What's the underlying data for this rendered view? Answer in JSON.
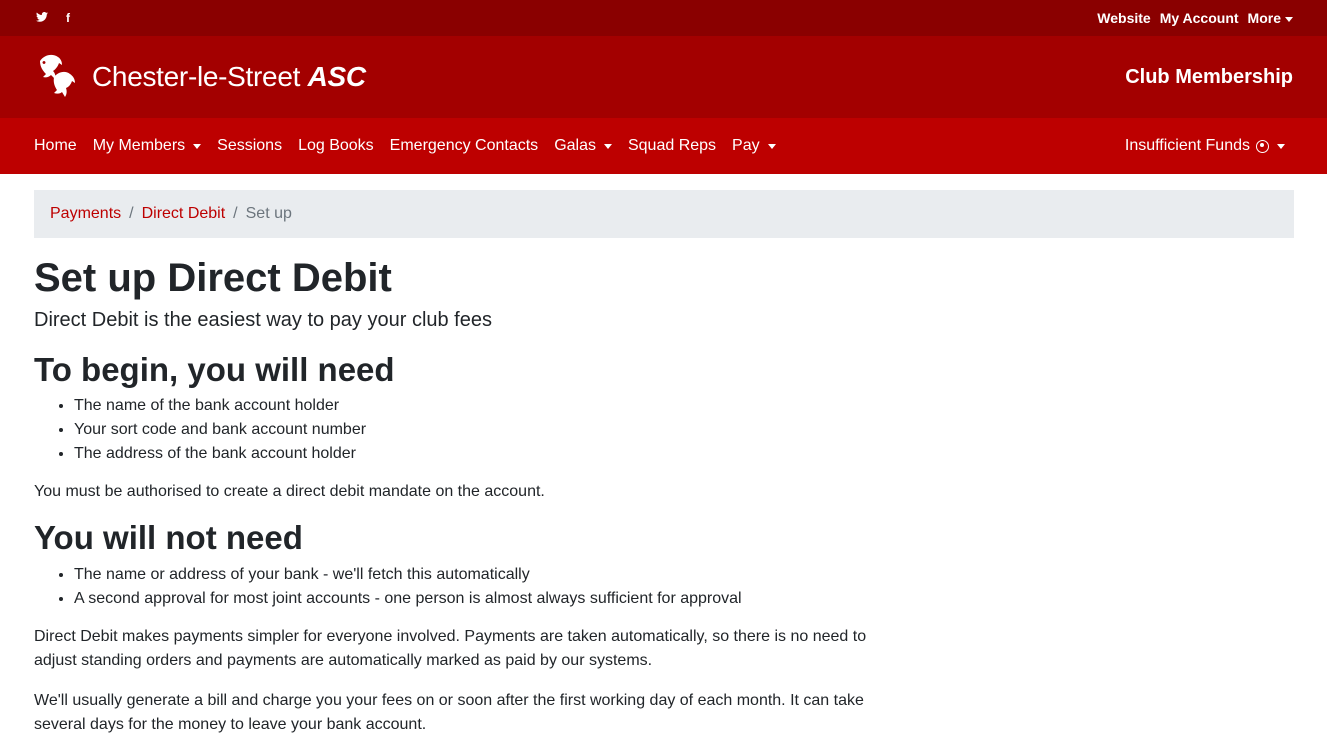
{
  "topbar": {
    "social": [
      "twitter-icon",
      "facebook-icon"
    ],
    "social_glyphs": {
      "twitter": "🐦",
      "facebook": "f"
    },
    "links": [
      "Website",
      "My Account",
      "More"
    ]
  },
  "brand": {
    "name_main": "Chester-le-Street ",
    "name_abbr": "ASC",
    "right_title": "Club Membership"
  },
  "nav": {
    "items": [
      {
        "label": "Home",
        "dropdown": false
      },
      {
        "label": "My Members",
        "dropdown": true
      },
      {
        "label": "Sessions",
        "dropdown": false
      },
      {
        "label": "Log Books",
        "dropdown": false
      },
      {
        "label": "Emergency Contacts",
        "dropdown": false
      },
      {
        "label": "Galas",
        "dropdown": true
      },
      {
        "label": "Squad Reps",
        "dropdown": false
      },
      {
        "label": "Pay",
        "dropdown": true
      }
    ],
    "user": "Insufficient Funds"
  },
  "breadcrumb": {
    "items": [
      "Payments",
      "Direct Debit"
    ],
    "active": "Set up"
  },
  "main": {
    "title": "Set up Direct Debit",
    "lead": "Direct Debit is the easiest way to pay your club fees",
    "need_heading": "To begin, you will need",
    "need_items": [
      "The name of the bank account holder",
      "Your sort code and bank account number",
      "The address of the bank account holder"
    ],
    "authorised_note": "You must be authorised to create a direct debit mandate on the account.",
    "not_need_heading": "You will not need",
    "not_need_items": [
      "The name or address of your bank - we'll fetch this automatically",
      "A second approval for most joint accounts - one person is almost always sufficient for approval"
    ],
    "para1": "Direct Debit makes payments simpler for everyone involved. Payments are taken automatically, so there is no need to adjust standing orders and payments are automatically marked as paid by our systems.",
    "para2": "We'll usually generate a bill and charge you your fees on or soon after the first working day of each month. It can take several days for the money to leave your bank account."
  },
  "colors": {
    "topbar": "#8a0000",
    "brandbar": "#a30000",
    "navbar": "#bd0000",
    "link": "#bd0000"
  }
}
